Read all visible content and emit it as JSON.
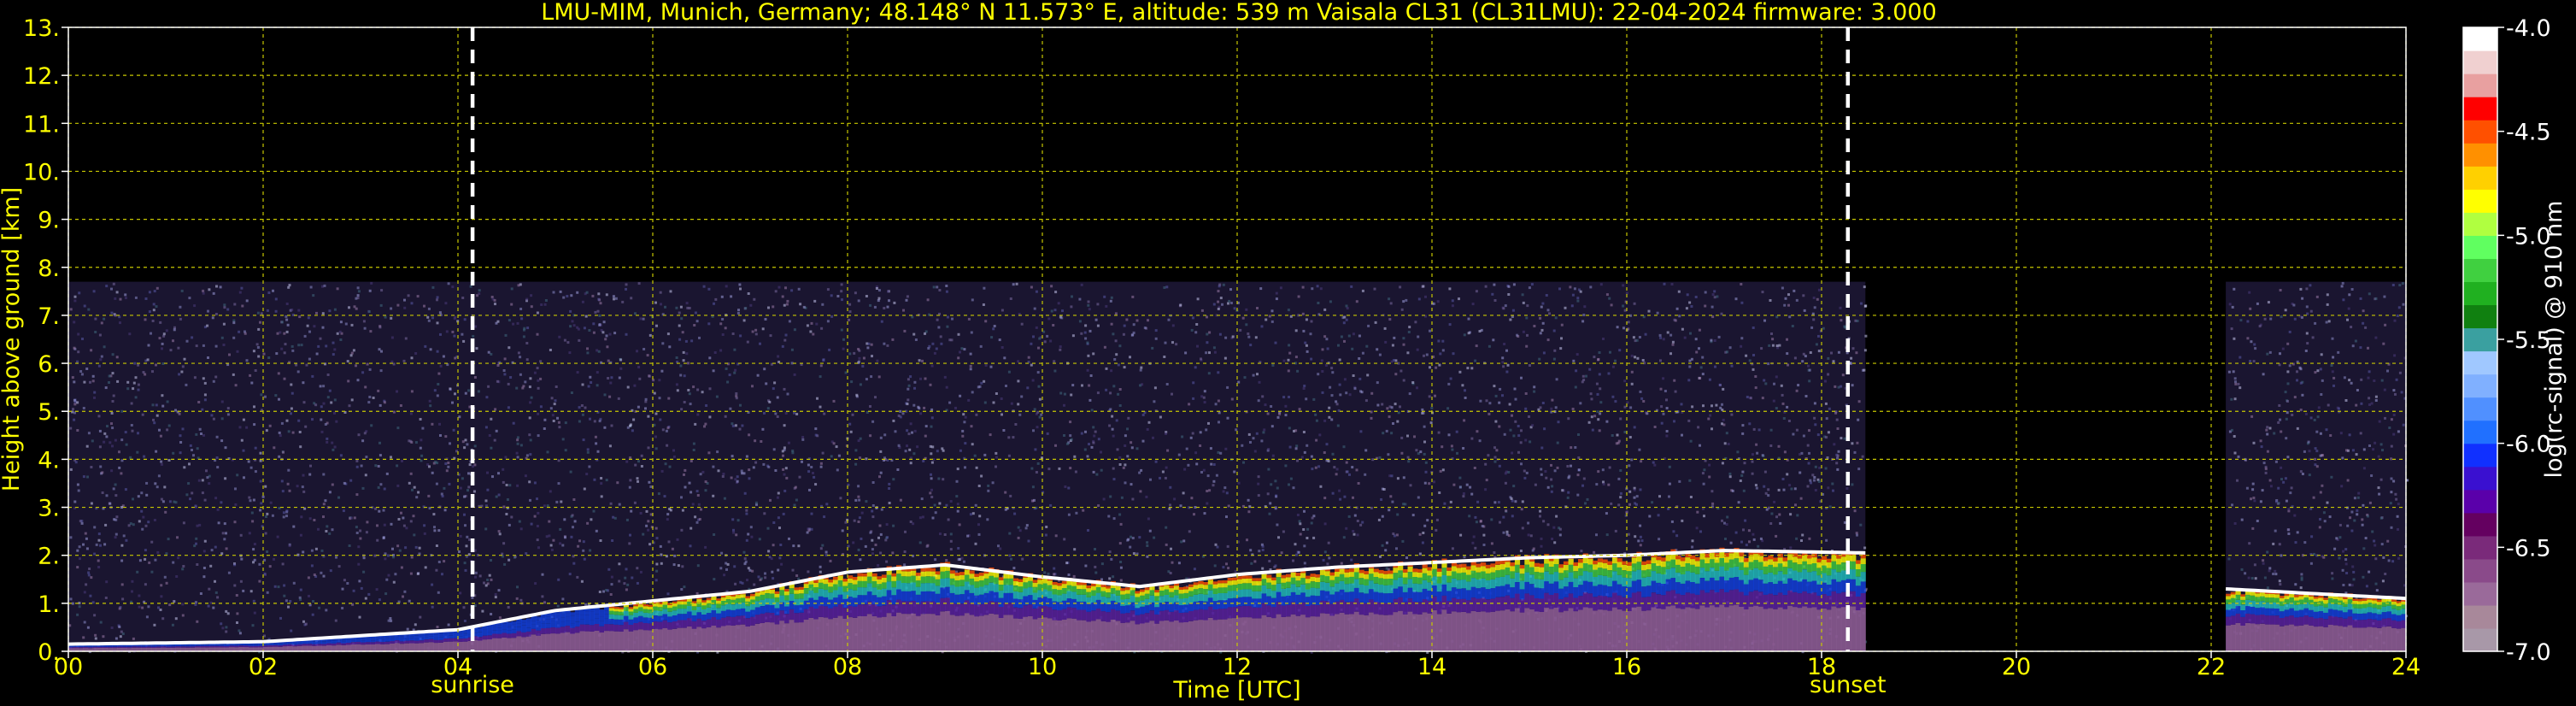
{
  "chart_data": {
    "type": "heatmap",
    "title": "LMU-MIM, Munich, Germany; 48.148° N 11.573° E, altitude: 539 m    Vaisala CL31 (CL31LMU): 22-04-2024    firmware: 3.000",
    "xlabel": "Time [UTC]",
    "ylabel": "Height above ground [km]",
    "xlim": [
      0,
      24
    ],
    "ylim": [
      0,
      13
    ],
    "x_ticks": [
      "00",
      "02",
      "04",
      "06",
      "08",
      "10",
      "12",
      "14",
      "16",
      "18",
      "20",
      "22",
      "24"
    ],
    "y_ticks": [
      "0.",
      "1.",
      "2.",
      "3.",
      "4.",
      "5.",
      "6.",
      "7.",
      "8.",
      "9.",
      "10.",
      "11.",
      "12.",
      "13."
    ],
    "grid": true,
    "events": [
      {
        "label": "sunrise",
        "time": 4.15
      },
      {
        "label": "sunset",
        "time": 18.27
      }
    ],
    "data_gaps": [
      [
        18.45,
        22.15
      ]
    ],
    "noise_top_km": 7.7,
    "boundary_layer_top_km": [
      [
        0,
        0.15
      ],
      [
        2,
        0.2
      ],
      [
        4,
        0.45
      ],
      [
        5,
        0.85
      ],
      [
        6,
        1.05
      ],
      [
        7,
        1.25
      ],
      [
        8,
        1.65
      ],
      [
        9,
        1.8
      ],
      [
        10,
        1.55
      ],
      [
        11,
        1.35
      ],
      [
        12,
        1.6
      ],
      [
        13,
        1.75
      ],
      [
        14,
        1.85
      ],
      [
        15,
        1.95
      ],
      [
        16,
        2.0
      ],
      [
        17,
        2.1
      ],
      [
        18.45,
        2.05
      ],
      [
        22.15,
        1.3
      ],
      [
        24,
        1.1
      ]
    ],
    "colorbar": {
      "label": "log(rc-signal) @ 910 nm",
      "range": [
        -7.0,
        -4.0
      ],
      "ticks": [
        "-4.0",
        "-4.5",
        "-5.0",
        "-5.5",
        "-6.0",
        "-6.5",
        "-7.0"
      ],
      "colors": [
        "#a898a8",
        "#a8889a",
        "#9a6a9a",
        "#8a4a8a",
        "#7a2a7a",
        "#640060",
        "#5a00aa",
        "#3a10d0",
        "#1030ff",
        "#2070ff",
        "#5090ff",
        "#80b0ff",
        "#a0c8ff",
        "#3aa0a0",
        "#108010",
        "#20b020",
        "#40d040",
        "#60ff60",
        "#b0ff40",
        "#ffff00",
        "#ffd000",
        "#ff9000",
        "#ff5000",
        "#ff0000",
        "#e8a0a0",
        "#f0d0d0",
        "#ffffff"
      ]
    }
  }
}
